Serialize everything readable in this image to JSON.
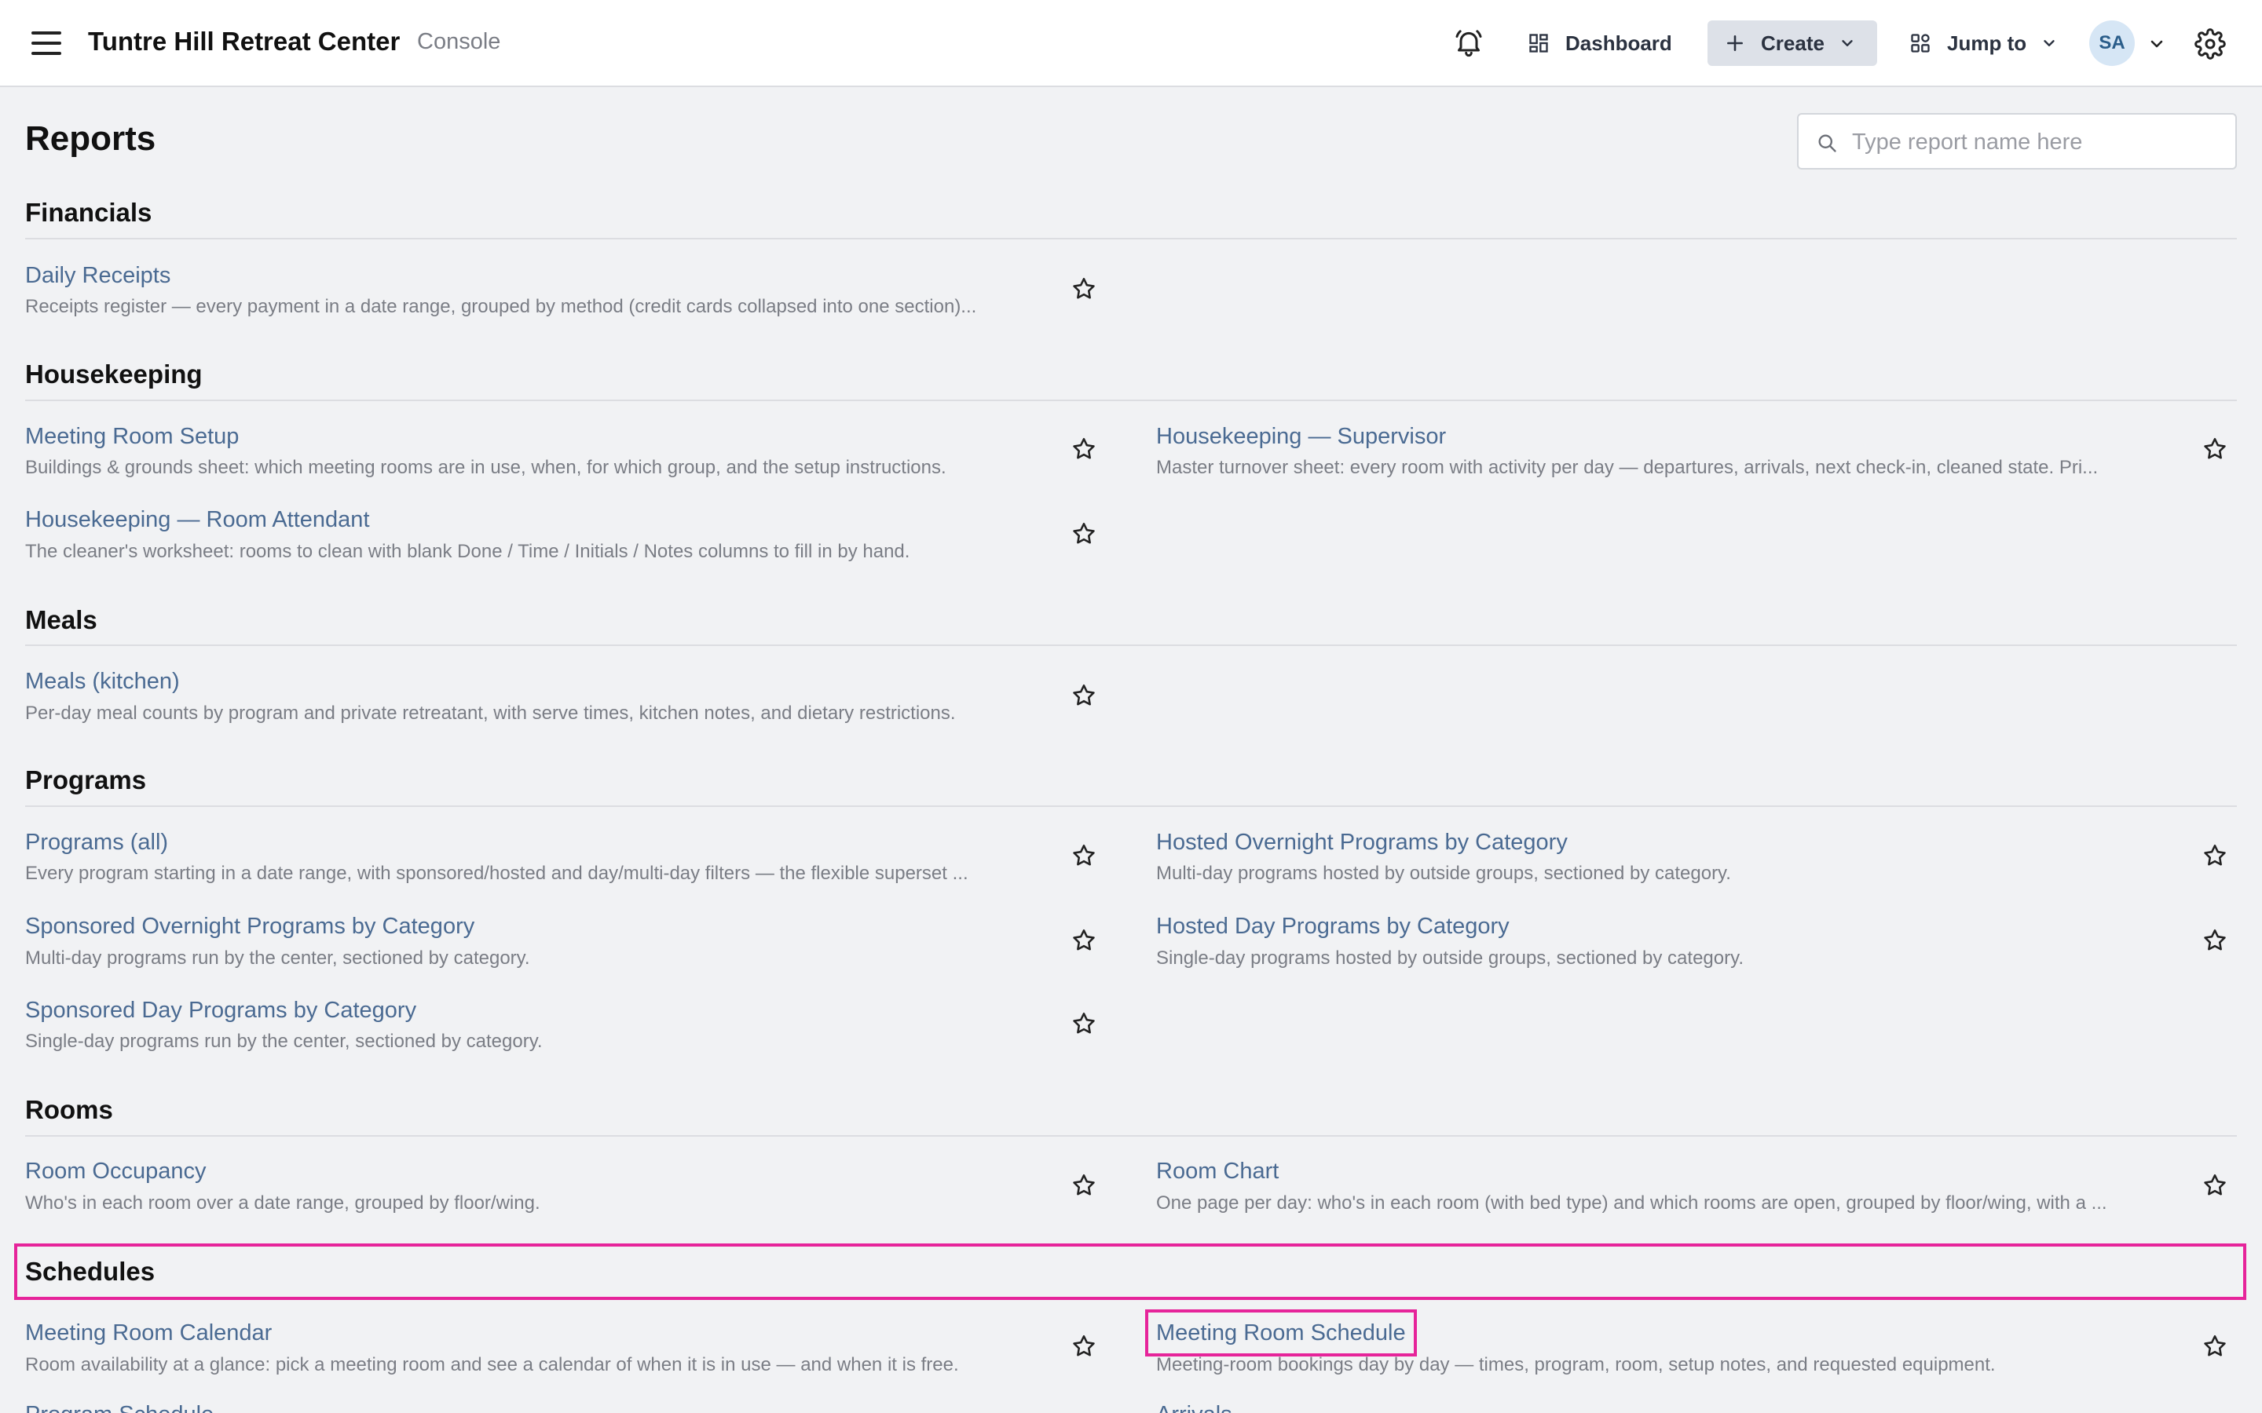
{
  "header": {
    "title": "Tuntre Hill Retreat Center",
    "subtitle": "Console",
    "dashboard_label": "Dashboard",
    "create_label": "Create",
    "jump_label": "Jump to",
    "avatar_initials": "SA"
  },
  "page": {
    "title": "Reports",
    "search_placeholder": "Type report name here"
  },
  "sections": {
    "financials": "Financials",
    "housekeeping": "Housekeeping",
    "meals": "Meals",
    "programs": "Programs",
    "rooms": "Rooms",
    "schedules": "Schedules"
  },
  "reports": {
    "daily_receipts": {
      "title": "Daily Receipts",
      "desc": "Receipts register — every payment in a date range, grouped by method (credit cards collapsed into one section)..."
    },
    "meeting_room_setup": {
      "title": "Meeting Room Setup",
      "desc": "Buildings & grounds sheet: which meeting rooms are in use, when, for which group, and the setup instructions."
    },
    "hk_supervisor": {
      "title": "Housekeeping — Supervisor",
      "desc": "Master turnover sheet: every room with activity per day — departures, arrivals, next check-in, cleaned state. Pri..."
    },
    "hk_attendant": {
      "title": "Housekeeping — Room Attendant",
      "desc": "The cleaner's worksheet: rooms to clean with blank Done / Time / Initials / Notes columns to fill in by hand."
    },
    "meals_kitchen": {
      "title": "Meals (kitchen)",
      "desc": "Per-day meal counts by program and private retreatant, with serve times, kitchen notes, and dietary restrictions."
    },
    "programs_all": {
      "title": "Programs (all)",
      "desc": "Every program starting in a date range, with sponsored/hosted and day/multi-day filters — the flexible superset ..."
    },
    "hosted_overnight": {
      "title": "Hosted Overnight Programs by Category",
      "desc": "Multi-day programs hosted by outside groups, sectioned by category."
    },
    "sponsored_overnight": {
      "title": "Sponsored Overnight Programs by Category",
      "desc": "Multi-day programs run by the center, sectioned by category."
    },
    "hosted_day": {
      "title": "Hosted Day Programs by Category",
      "desc": "Single-day programs hosted by outside groups, sectioned by category."
    },
    "sponsored_day": {
      "title": "Sponsored Day Programs by Category",
      "desc": "Single-day programs run by the center, sectioned by category."
    },
    "room_occupancy": {
      "title": "Room Occupancy",
      "desc": "Who's in each room over a date range, grouped by floor/wing."
    },
    "room_chart": {
      "title": "Room Chart",
      "desc": "One page per day: who's in each room (with bed type) and which rooms are open, grouped by floor/wing, with a ..."
    },
    "meeting_room_calendar": {
      "title": "Meeting Room Calendar",
      "desc": "Room availability at a glance: pick a meeting room and see a calendar of when it is in use — and when it is free."
    },
    "meeting_room_schedule": {
      "title": "Meeting Room Schedule",
      "desc": "Meeting-room bookings day by day — times, program, room, setup notes, and requested equipment."
    },
    "program_schedule": {
      "title": "Program Schedule"
    },
    "arrivals": {
      "title": "Arrivals"
    }
  },
  "colors": {
    "accent_highlight": "#e6249a",
    "link": "#4a6a92",
    "background": "#f1f2f4"
  },
  "icons": [
    "menu-icon",
    "bell-icon",
    "dashboard-icon",
    "plus-icon",
    "chevron-down-icon",
    "jump-icon",
    "gear-icon",
    "search-icon",
    "star-icon"
  ]
}
